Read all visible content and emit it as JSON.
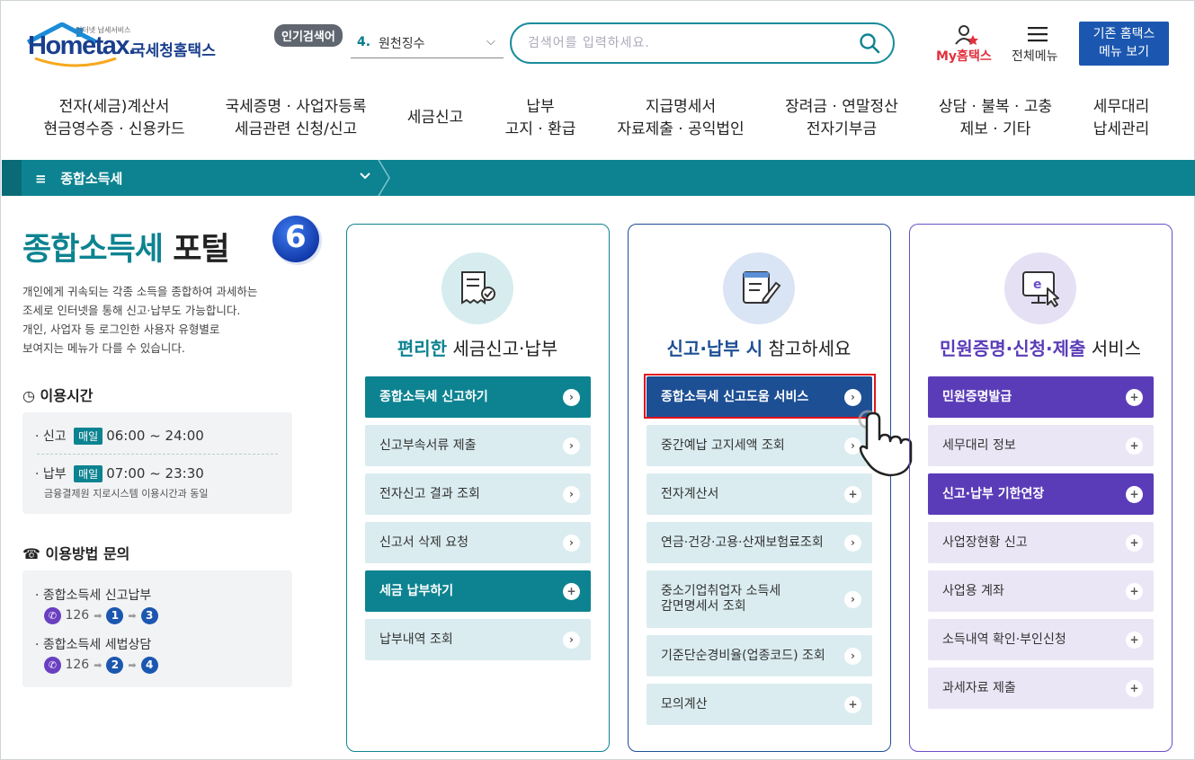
{
  "header": {
    "logo_text": "Hometax.",
    "logo_sub": "인터넷 납세서비스",
    "logo_kr": "국세청홈택스",
    "popular_badge": "인기검색어",
    "popular_rank": "4.",
    "popular_term": "원천징수",
    "search_placeholder": "검색어를 입력하세요.",
    "my_hometax": "My홈택스",
    "all_menu": "전체메뉴",
    "old_home_1": "기존 홈택스",
    "old_home_2": "메뉴 보기"
  },
  "gnb": [
    {
      "l1": "전자(세금)계산서",
      "l2": "현금영수증 · 신용카드"
    },
    {
      "l1": "국세증명 · 사업자등록",
      "l2": "세금관련 신청/신고"
    },
    {
      "l1": "세금신고",
      "l2": ""
    },
    {
      "l1": "납부",
      "l2": "고지 · 환급"
    },
    {
      "l1": "지급명세서",
      "l2": "자료제출 · 공익법인"
    },
    {
      "l1": "장려금 · 연말정산",
      "l2": "전자기부금"
    },
    {
      "l1": "상담 · 불복 · 고충",
      "l2": "제보 · 기타"
    },
    {
      "l1": "세무대리",
      "l2": "납세관리"
    }
  ],
  "breadcrumb": {
    "label": "종합소득세"
  },
  "portal": {
    "title_1": "종합소득세",
    "title_2": "포털",
    "step": "6",
    "desc": [
      "개인에게 귀속되는 각종 소득을 종합하여 과세하는",
      "조세로 인터넷을 통해 신고·납부도 가능합니다.",
      "개인, 사업자 등 로그인한 사용자 유형별로",
      "보여지는 메뉴가 다를 수 있습니다."
    ],
    "hours_title": "이용시간",
    "hours": [
      {
        "label": "신고",
        "tag": "매일",
        "time": "06:00 ~ 24:00"
      },
      {
        "label": "납부",
        "tag": "매일",
        "time": "07:00 ~ 23:30"
      }
    ],
    "hours_note": "금융결제원 지로시스템 이용시간과 동일",
    "inquiry_title": "이용방법 문의",
    "inquiries": [
      {
        "label": "종합소득세 신고납부",
        "num": "126",
        "s1": "1",
        "s2": "3"
      },
      {
        "label": "종합소득세 세법상담",
        "num": "126",
        "s1": "2",
        "s2": "4"
      }
    ]
  },
  "cards": [
    {
      "title_a": "편리한",
      "title_b": "세금신고·납부",
      "items": [
        {
          "label": "종합소득세 신고하기",
          "icon": "›"
        },
        {
          "label": "신고부속서류 제출",
          "icon": "›"
        },
        {
          "label": "전자신고 결과 조회",
          "icon": "›"
        },
        {
          "label": "신고서 삭제 요청",
          "icon": "›"
        },
        {
          "label": "세금 납부하기",
          "icon": "+"
        },
        {
          "label": "납부내역 조회",
          "icon": "›"
        }
      ]
    },
    {
      "title_a": "신고·납부 시",
      "title_b": "참고하세요",
      "items": [
        {
          "label": "종합소득세 신고도움 서비스",
          "icon": "›"
        },
        {
          "label": "중간예납 고지세액 조회",
          "icon": "›"
        },
        {
          "label": "전자계산서",
          "icon": "+"
        },
        {
          "label": "연금·건강·고용·산재보험료조회",
          "icon": "›"
        },
        {
          "label": "중소기업취업자 소득세 감면명세서 조회",
          "icon": "›"
        },
        {
          "label": "기준단순경비율(업종코드) 조회",
          "icon": "›"
        },
        {
          "label": "모의계산",
          "icon": "+"
        }
      ]
    },
    {
      "title_a": "민원증명·신청·제출",
      "title_b": "서비스",
      "items": [
        {
          "label": "민원증명발급",
          "icon": "+"
        },
        {
          "label": "세무대리 정보",
          "icon": "+"
        },
        {
          "label": "신고·납부 기한연장",
          "icon": "+"
        },
        {
          "label": "사업장현황 신고",
          "icon": "+"
        },
        {
          "label": "사업용 계좌",
          "icon": "+"
        },
        {
          "label": "소득내역 확인·부인신청",
          "icon": "+"
        },
        {
          "label": "과세자료 제출",
          "icon": "+"
        }
      ]
    }
  ],
  "colors": {
    "teal": "#0d8391",
    "navy": "#1d4f94",
    "purple": "#5b3cb8",
    "red": "#e0151e"
  }
}
